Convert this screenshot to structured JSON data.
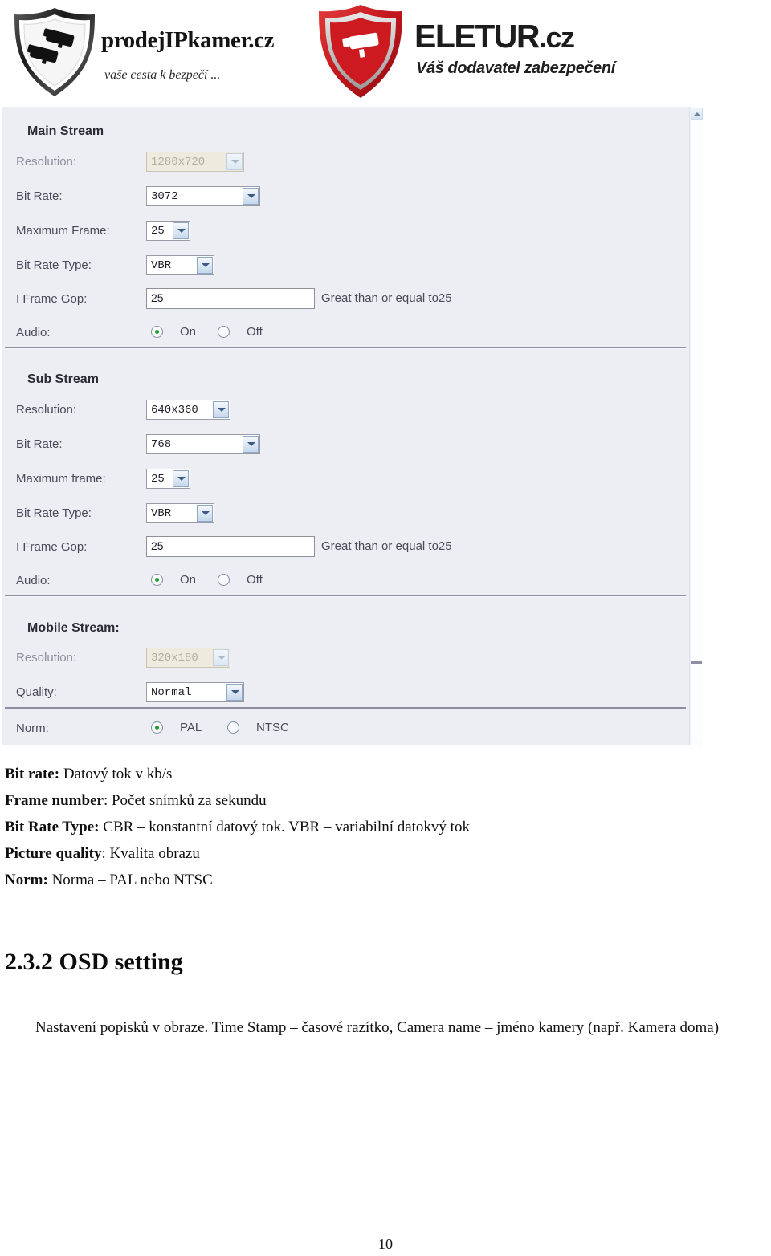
{
  "header": {
    "logo_left": {
      "name": "prodejIPkamer.cz",
      "tagline": "vaše cesta k bezpečí ...",
      "icon": "shield-cctv-camera-dark"
    },
    "logo_right": {
      "name": "ELETUR",
      "tld": ".cz",
      "tagline": "Váš dodavatel zabezpečení",
      "icon": "shield-cctv-camera-red"
    }
  },
  "screenshot": {
    "scrollbar": {
      "up_arrow_icon": "chevron-up-icon"
    },
    "sections": [
      {
        "title": "Main Stream",
        "rows": [
          {
            "label": "Resolution:",
            "type": "select",
            "value": "1280x720",
            "disabled": true,
            "icon": "chevron-down-icon"
          },
          {
            "label": "Bit Rate:",
            "type": "select",
            "value": "3072",
            "disabled": false,
            "icon": "chevron-down-icon"
          },
          {
            "label": "Maximum Frame:",
            "type": "select",
            "value": "25",
            "disabled": false,
            "icon": "chevron-down-icon"
          },
          {
            "label": "Bit Rate Type:",
            "type": "select",
            "value": "VBR",
            "disabled": false,
            "icon": "chevron-down-icon"
          },
          {
            "label": "I Frame Gop:",
            "type": "input",
            "value": "25",
            "hint": "Great than or equal to25"
          },
          {
            "label": "Audio:",
            "type": "radio",
            "options": [
              "On",
              "Off"
            ],
            "selected": "On"
          }
        ]
      },
      {
        "title": "Sub Stream",
        "rows": [
          {
            "label": "Resolution:",
            "type": "select",
            "value": "640x360",
            "disabled": false,
            "icon": "chevron-down-icon"
          },
          {
            "label": "Bit Rate:",
            "type": "select",
            "value": "768",
            "disabled": false,
            "icon": "chevron-down-icon"
          },
          {
            "label": "Maximum frame:",
            "type": "select",
            "value": "25",
            "disabled": false,
            "icon": "chevron-down-icon"
          },
          {
            "label": "Bit Rate Type:",
            "type": "select",
            "value": "VBR",
            "disabled": false,
            "icon": "chevron-down-icon"
          },
          {
            "label": "I Frame Gop:",
            "type": "input",
            "value": "25",
            "hint": "Great than or equal to25"
          },
          {
            "label": "Audio:",
            "type": "radio",
            "options": [
              "On",
              "Off"
            ],
            "selected": "On"
          }
        ]
      },
      {
        "title": "Mobile Stream:",
        "rows": [
          {
            "label": "Resolution:",
            "type": "select",
            "value": "320x180",
            "disabled": true,
            "icon": "chevron-down-icon"
          },
          {
            "label": "Quality:",
            "type": "select",
            "value": "Normal",
            "disabled": false,
            "icon": "chevron-down-icon"
          }
        ]
      },
      {
        "title": "",
        "rows": [
          {
            "label": "Norm:",
            "type": "radio",
            "options": [
              "PAL",
              "NTSC"
            ],
            "selected": "PAL"
          }
        ]
      }
    ]
  },
  "glossary": [
    {
      "term": "Bit rate:",
      "definition": " Datový tok v kb/s"
    },
    {
      "term": "Frame number",
      "definition": ": Počet snímků za sekundu"
    },
    {
      "term": "Bit Rate Type:",
      "definition": " CBR – konstantní datový tok. VBR – variabilní datokvý tok"
    },
    {
      "term": "Picture quality",
      "definition": ": Kvalita obrazu"
    },
    {
      "term": "Norm:",
      "definition": " Norma – PAL nebo NTSC"
    }
  ],
  "section_heading": "2.3.2 OSD setting",
  "paragraph": "Nastavení popisků v obraze. Time Stamp – časové razítko, Camera name – jméno kamery (např. Kamera doma)",
  "page_number": "10"
}
